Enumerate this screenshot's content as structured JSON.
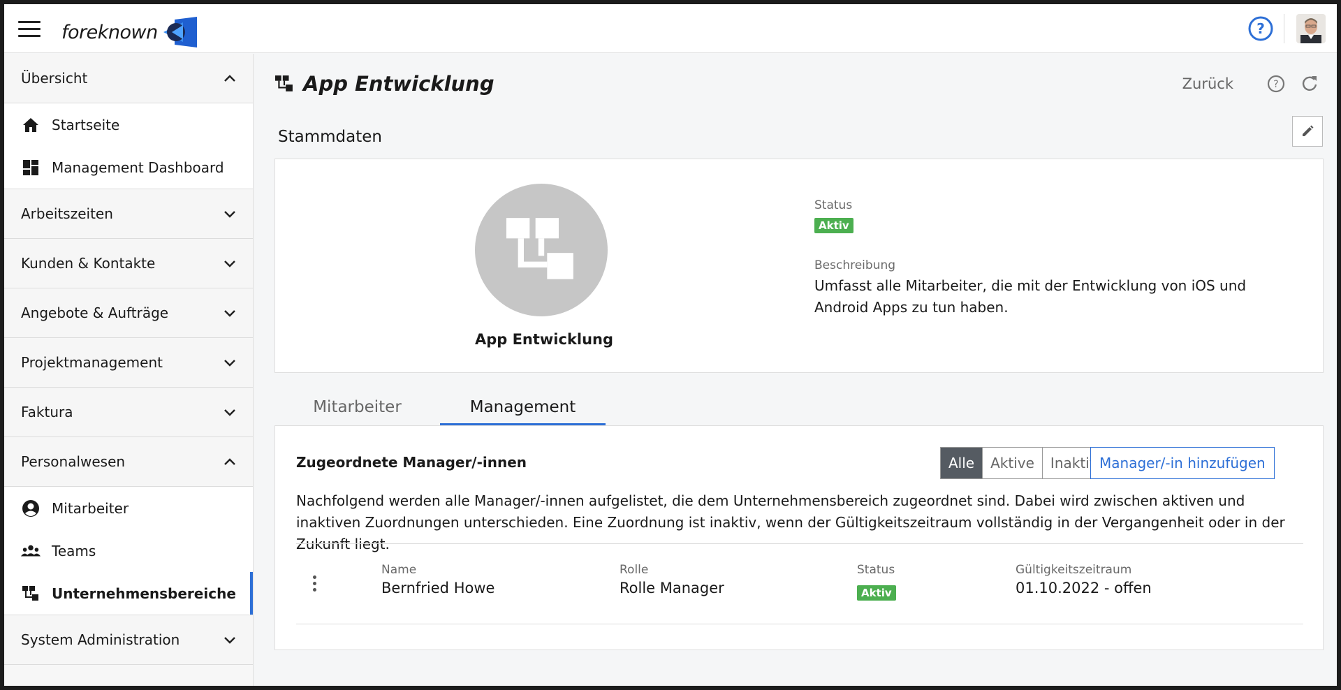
{
  "app": {
    "logo_text": "foreknown",
    "brand_color": "#2d6fd6"
  },
  "sidebar": {
    "sections": [
      {
        "label": "Übersicht",
        "expanded": true,
        "items": [
          {
            "label": "Startseite",
            "icon": "home-icon"
          },
          {
            "label": "Management Dashboard",
            "icon": "dashboard-icon"
          }
        ]
      },
      {
        "label": "Arbeitszeiten",
        "expanded": false
      },
      {
        "label": "Kunden & Kontakte",
        "expanded": false
      },
      {
        "label": "Angebote & Aufträge",
        "expanded": false
      },
      {
        "label": "Projektmanagement",
        "expanded": false
      },
      {
        "label": "Faktura",
        "expanded": false
      },
      {
        "label": "Personalwesen",
        "expanded": true,
        "items": [
          {
            "label": "Mitarbeiter",
            "icon": "account-circle-icon"
          },
          {
            "label": "Teams",
            "icon": "group-icon"
          },
          {
            "label": "Unternehmensbereiche",
            "icon": "org-unit-icon",
            "active": true
          }
        ]
      },
      {
        "label": "System Administration",
        "expanded": false
      }
    ]
  },
  "header": {
    "title": "App Entwicklung",
    "back_label": "Zurück"
  },
  "stammdaten": {
    "section_title": "Stammdaten",
    "name": "App Entwicklung",
    "status_label": "Status",
    "status_value": "Aktiv",
    "description_label": "Beschreibung",
    "description": "Umfasst alle Mitarbeiter, die mit der Entwicklung von iOS und Android Apps zu tun haben."
  },
  "tabs": [
    {
      "label": "Mitarbeiter",
      "active": false
    },
    {
      "label": "Management",
      "active": true
    }
  ],
  "management": {
    "title": "Zugeordnete Manager/-innen",
    "filters": [
      {
        "label": "Alle",
        "selected": true
      },
      {
        "label": "Aktive",
        "selected": false
      },
      {
        "label": "Inaktive",
        "selected": false
      }
    ],
    "add_label": "Manager/-in hinzufügen",
    "description": "Nachfolgend werden alle Manager/-innen aufgelistet, die dem Unternehmensbereich zugeordnet sind. Dabei wird zwischen aktiven und inaktiven Zuordnungen unterschieden. Eine Zuordnung ist inaktiv, wenn der Gültigkeitszeitraum vollständig in der Vergangenheit oder in der Zukunft liegt.",
    "columns": [
      "Name",
      "Rolle",
      "Status",
      "Gültigkeitszeitraum"
    ],
    "rows": [
      {
        "name": "Bernfried Howe",
        "role": "Rolle Manager",
        "status": "Aktiv",
        "validity": "01.10.2022 - offen"
      }
    ],
    "status_color": "#4caf50"
  }
}
